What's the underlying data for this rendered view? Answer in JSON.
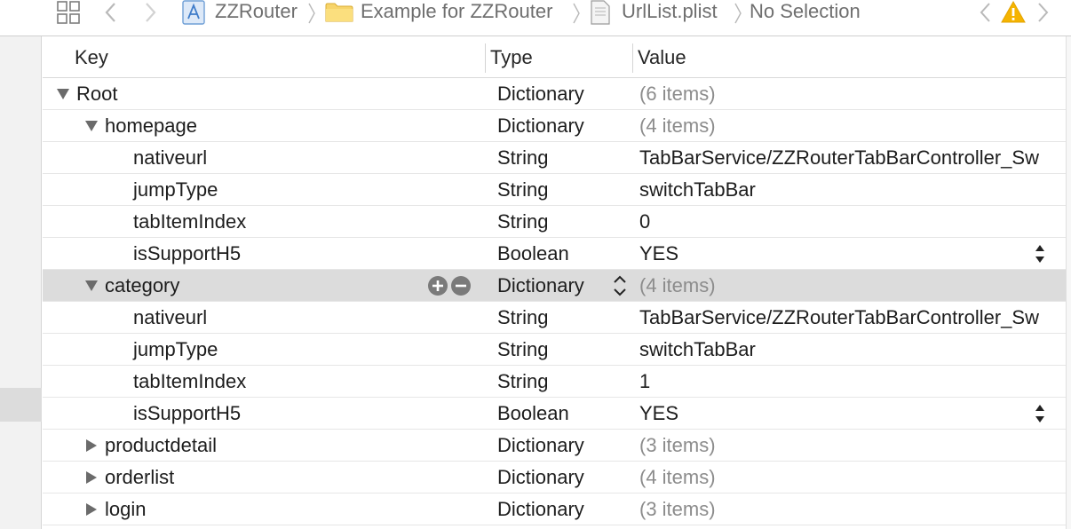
{
  "jumpbar": {
    "crumbs": [
      "ZZRouter",
      "Example for ZZRouter",
      "UrlList.plist",
      "No Selection"
    ]
  },
  "columns": {
    "key": "Key",
    "type": "Type",
    "value": "Value"
  },
  "rows": [
    {
      "key": "Root",
      "type": "Dictionary",
      "value": "(6 items)"
    },
    {
      "key": "homepage",
      "type": "Dictionary",
      "value": "(4 items)"
    },
    {
      "key": "nativeurl",
      "type": "String",
      "value": "TabBarService/ZZRouterTabBarController_Sw"
    },
    {
      "key": "jumpType",
      "type": "String",
      "value": "switchTabBar"
    },
    {
      "key": "tabItemIndex",
      "type": "String",
      "value": "0"
    },
    {
      "key": "isSupportH5",
      "type": "Boolean",
      "value": "YES"
    },
    {
      "key": "category",
      "type": "Dictionary",
      "value": "(4 items)"
    },
    {
      "key": "nativeurl",
      "type": "String",
      "value": "TabBarService/ZZRouterTabBarController_Sw"
    },
    {
      "key": "jumpType",
      "type": "String",
      "value": "switchTabBar"
    },
    {
      "key": "tabItemIndex",
      "type": "String",
      "value": "1"
    },
    {
      "key": "isSupportH5",
      "type": "Boolean",
      "value": "YES"
    },
    {
      "key": "productdetail",
      "type": "Dictionary",
      "value": "(3 items)"
    },
    {
      "key": "orderlist",
      "type": "Dictionary",
      "value": "(4 items)"
    },
    {
      "key": "login",
      "type": "Dictionary",
      "value": "(3 items)"
    }
  ],
  "colors": {
    "selected_row": "#dcdcdc",
    "warning": "#f5b400",
    "dim_text": "#8c8c8c"
  }
}
